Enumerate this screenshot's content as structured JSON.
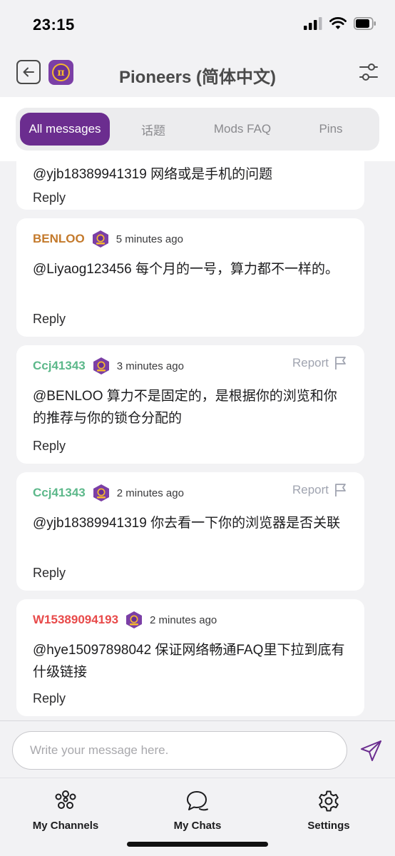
{
  "status_bar": {
    "time": "23:15"
  },
  "header": {
    "title": "Pioneers (简体中文)",
    "logo_glyph": "π"
  },
  "tabs": [
    {
      "label": "All messages",
      "active": true
    },
    {
      "label": "话题",
      "active": false
    },
    {
      "label": "Mods FAQ",
      "active": false
    },
    {
      "label": "Pins",
      "active": false
    }
  ],
  "messages": [
    {
      "user": "",
      "time": "",
      "text": "@yjb18389941319 网络或是手机的问题",
      "reply": "Reply",
      "report": ""
    },
    {
      "user": "BENLOO",
      "user_color": "#c47a2c",
      "time": "5 minutes ago",
      "text": "@Liyaog123456 每个月的一号，算力都不一样的。",
      "reply": "Reply",
      "report": ""
    },
    {
      "user": "Ccj41343",
      "user_color": "#5cb88a",
      "time": "3 minutes ago",
      "text": "@BENLOO 算力不是固定的，是根据你的浏览和你的推荐与你的锁仓分配的",
      "reply": "Reply",
      "report": "Report"
    },
    {
      "user": "Ccj41343",
      "user_color": "#5cb88a",
      "time": "2 minutes ago",
      "text": "@yjb18389941319 你去看一下你的浏览器是否关联",
      "reply": "Reply",
      "report": "Report"
    },
    {
      "user": "W15389094193",
      "user_color": "#e84a4a",
      "time": "2 minutes ago",
      "text": "@hye15097898042 保证网络畅通FAQ里下拉到底有什级链接",
      "reply": "Reply",
      "report": ""
    }
  ],
  "composer": {
    "placeholder": "Write your message here."
  },
  "nav": [
    {
      "label": "My Channels",
      "icon": "channels-icon"
    },
    {
      "label": "My Chats",
      "icon": "chats-icon"
    },
    {
      "label": "Settings",
      "icon": "gear-icon"
    }
  ],
  "colors": {
    "accent": "#6b2d8f",
    "badge": "#7b3fa6"
  }
}
